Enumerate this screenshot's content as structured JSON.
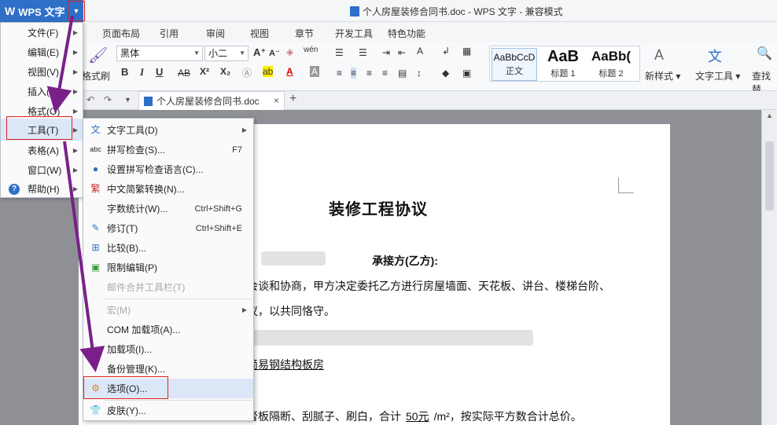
{
  "app": {
    "name": "WPS 文字",
    "window_title": "个人房屋装修合同书.doc - WPS 文字 - 兼容模式"
  },
  "tabs": [
    "页面布局",
    "引用",
    "审阅",
    "视图",
    "章节",
    "开发工具",
    "特色功能"
  ],
  "ribbon": {
    "format_painter": "格式刷",
    "font_name": "黑体",
    "font_size": "小二",
    "bold": "B",
    "italic": "I",
    "underline": "U",
    "styles": [
      {
        "sample": "AaBbCcD",
        "label": "正文"
      },
      {
        "sample": "AaB",
        "label": "标题 1"
      },
      {
        "sample": "AaBb(",
        "label": "标题 2"
      }
    ],
    "new_style": "新样式",
    "text_tools": "文字工具",
    "find_replace": "查找替"
  },
  "doc_tab": {
    "name": "个人房屋装修合同书.doc",
    "close": "×",
    "add": "+"
  },
  "main_menu": {
    "items": [
      {
        "label": "文件(F)"
      },
      {
        "label": "编辑(E)"
      },
      {
        "label": "视图(V)"
      },
      {
        "label": "插入(I)"
      },
      {
        "label": "格式(O)"
      },
      {
        "label": "工具(T)"
      },
      {
        "label": "表格(A)"
      },
      {
        "label": "窗口(W)"
      },
      {
        "label": "帮助(H)"
      }
    ]
  },
  "tools_menu": {
    "items": [
      {
        "label": "文字工具(D)",
        "shortcut": ""
      },
      {
        "label": "拼写检查(S)...",
        "shortcut": "F7"
      },
      {
        "label": "设置拼写检查语言(C)...",
        "shortcut": ""
      },
      {
        "label": "中文简繁转换(N)...",
        "shortcut": ""
      },
      {
        "label": "字数统计(W)...",
        "shortcut": "Ctrl+Shift+G"
      },
      {
        "label": "修订(T)",
        "shortcut": "Ctrl+Shift+E"
      },
      {
        "label": "比较(B)...",
        "shortcut": ""
      },
      {
        "label": "限制编辑(P)",
        "shortcut": ""
      },
      {
        "label": "邮件合并工具栏(T)",
        "shortcut": ""
      },
      {
        "label": "宏(M)",
        "shortcut": ""
      },
      {
        "label": "COM 加载项(A)...",
        "shortcut": ""
      },
      {
        "label": "加载项(I)...",
        "shortcut": ""
      },
      {
        "label": "备份管理(K)...",
        "shortcut": ""
      },
      {
        "label": "选项(O)...",
        "shortcut": ""
      },
      {
        "label": "皮肤(Y)...",
        "shortcut": ""
      }
    ]
  },
  "document": {
    "title": "装修工程协议",
    "line1_right": "承接方(乙方):",
    "line2": "会谈和协商，甲方决定委托乙方进行房屋墙面、天花板、讲台、楼梯台阶、",
    "line3": "议，以共同恪守。",
    "line4": "简易钢结构板房",
    "line5_a": "膏板隔断、刮腻子、刷白，合计",
    "line5_price": "50元",
    "line5_b": "/m²，按实际平方数合计总价。"
  },
  "colors": {
    "accent": "#2e6fc7",
    "highlight": "#e02020",
    "arrow": "#7a1f8a"
  }
}
